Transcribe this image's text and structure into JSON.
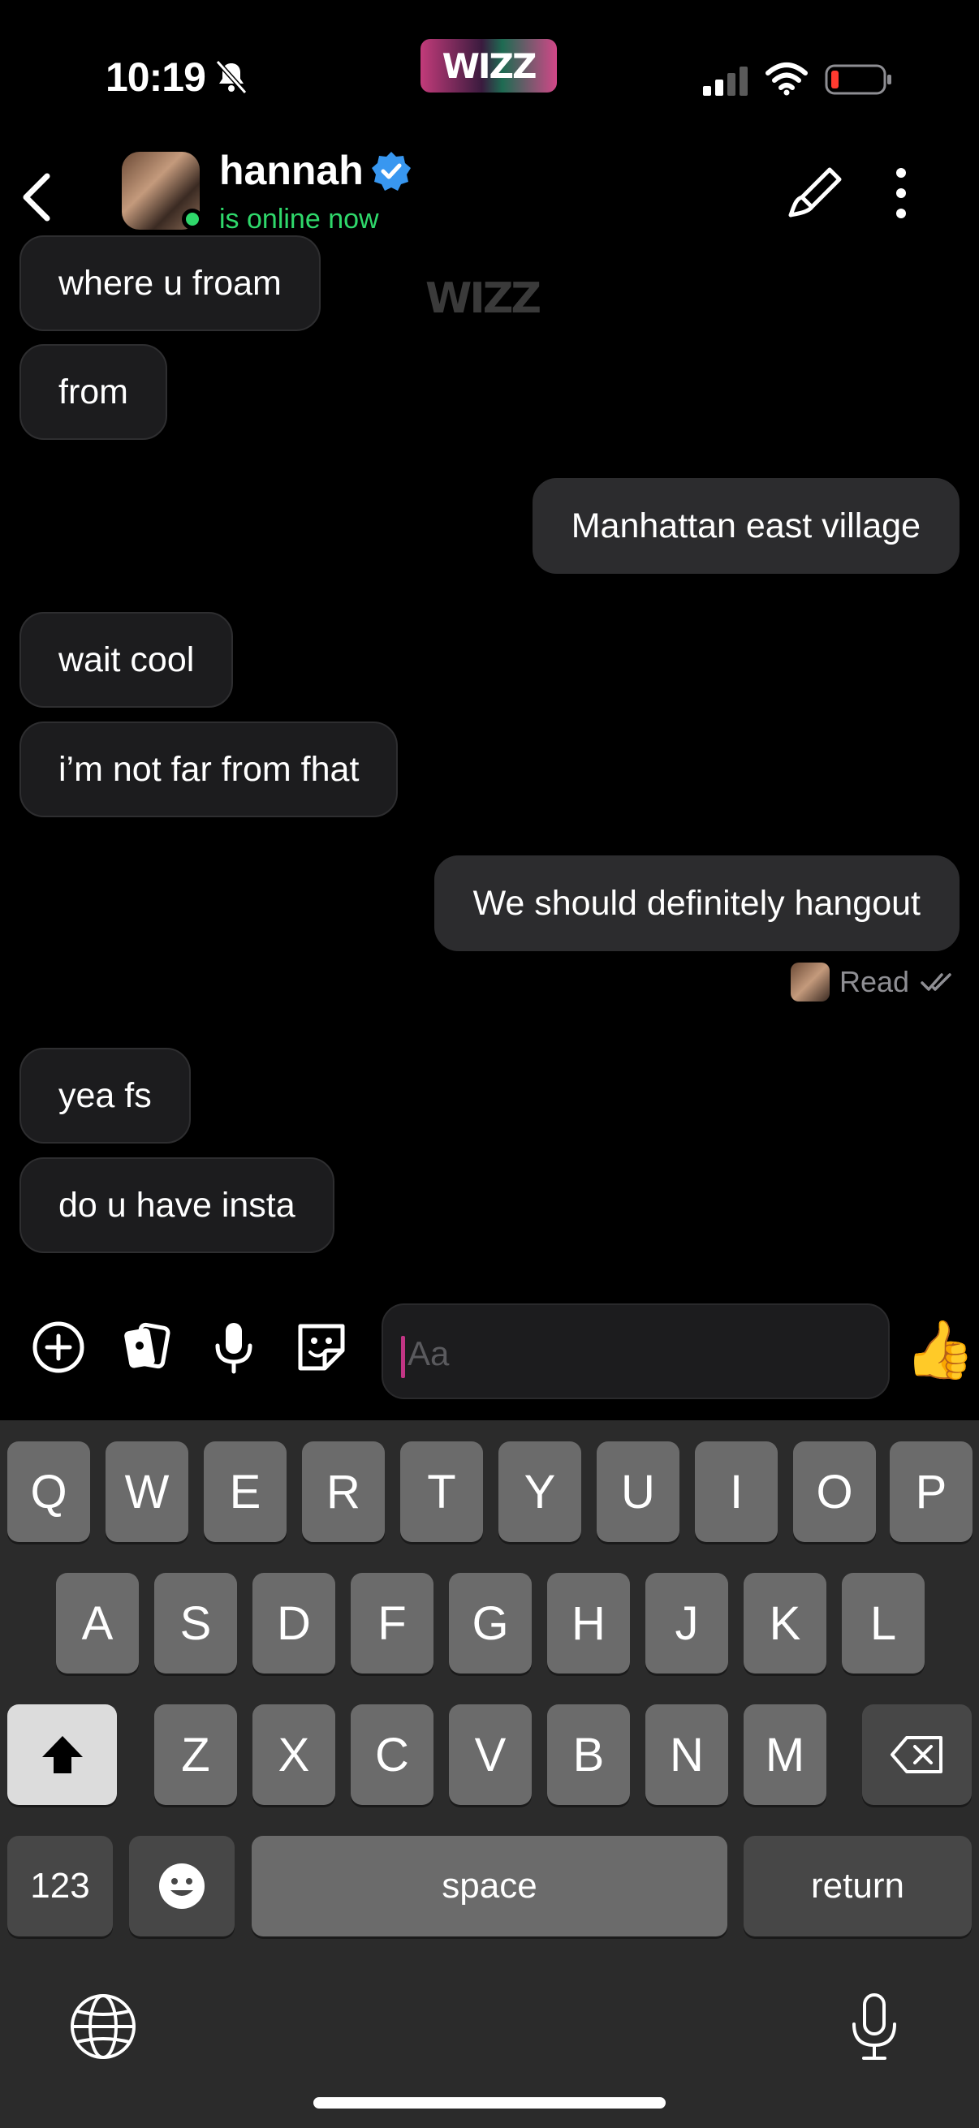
{
  "status_bar": {
    "time": "10:19",
    "logo_text": "WIZZ",
    "icons": [
      "bell-slash-icon",
      "signal-icon",
      "wifi-icon",
      "battery-low-icon"
    ]
  },
  "header": {
    "back_icon": "chevron-left-icon",
    "name": "hannah",
    "verified_icon": "verified-badge-icon",
    "presence": "is online now",
    "actions": [
      "brush-icon",
      "more-vertical-icon"
    ]
  },
  "watermark": "WIZZ",
  "messages": [
    {
      "side": "in",
      "text": "where u froam"
    },
    {
      "side": "in",
      "text": "from"
    },
    {
      "side": "out",
      "text": "Manhattan east village"
    },
    {
      "side": "in",
      "text": "wait cool"
    },
    {
      "side": "in",
      "text": "i’m not far from fhat"
    },
    {
      "side": "out",
      "text": "We should definitely hangout"
    },
    {
      "side": "in",
      "text": "yea fs"
    },
    {
      "side": "in",
      "text": "do u have insta"
    }
  ],
  "read_receipt": {
    "label": "Read"
  },
  "composer": {
    "placeholder": "Aa",
    "icons": [
      "add-circle-icon",
      "cards-icon",
      "microphone-icon",
      "sticker-icon"
    ],
    "thumb": "👍"
  },
  "keyboard": {
    "row1": [
      "Q",
      "W",
      "E",
      "R",
      "T",
      "Y",
      "U",
      "I",
      "O",
      "P"
    ],
    "row2": [
      "A",
      "S",
      "D",
      "F",
      "G",
      "H",
      "J",
      "K",
      "L"
    ],
    "row3": [
      "Z",
      "X",
      "C",
      "V",
      "B",
      "N",
      "M"
    ],
    "numbers_label": "123",
    "space_label": "space",
    "return_label": "return"
  },
  "colors": {
    "online": "#2fd86b",
    "accent": "#c13584",
    "bubble_in": "#1c1c1e",
    "bubble_out": "#2c2c2e"
  }
}
